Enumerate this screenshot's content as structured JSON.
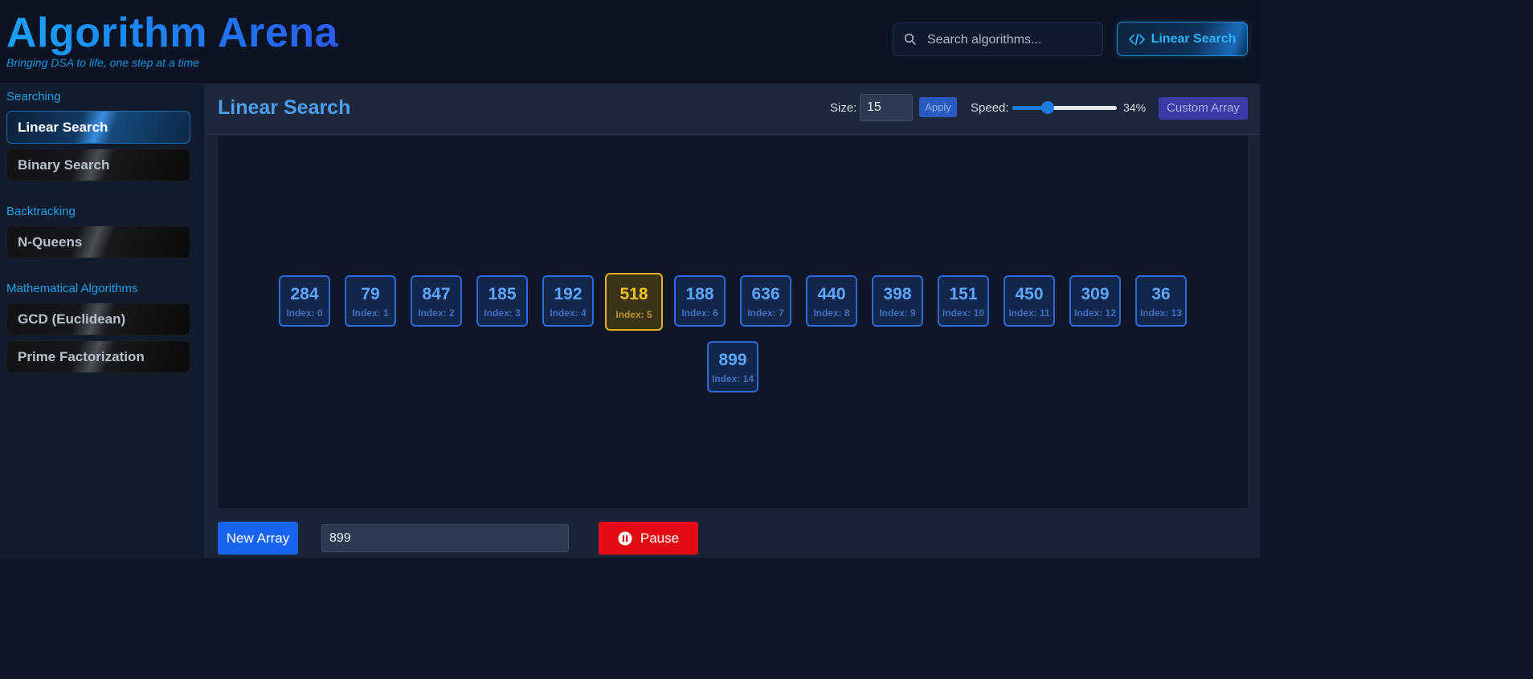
{
  "header": {
    "title": "Algorithm Arena",
    "tagline": "Bringing DSA to life, one step at a time",
    "search_placeholder": "Search algorithms...",
    "current_algorithm": "Linear Search"
  },
  "sidebar": {
    "groups": [
      {
        "title": "Searching",
        "items": [
          {
            "label": "Linear Search",
            "active": true
          },
          {
            "label": "Binary Search"
          }
        ]
      },
      {
        "title": "Backtracking",
        "items": [
          {
            "label": "N-Queens"
          }
        ]
      },
      {
        "title": "Mathematical Algorithms",
        "items": [
          {
            "label": "GCD (Euclidean)"
          },
          {
            "label": "Prime Factorization"
          }
        ]
      }
    ]
  },
  "main": {
    "title": "Linear Search",
    "size_label": "Size:",
    "size_value": "15",
    "apply_label": "Apply",
    "speed_label": "Speed:",
    "speed_percent": 34,
    "speed_text": "34%",
    "custom_array_label": "Custom Array",
    "array": [
      {
        "value": "284",
        "index": "Index: 0"
      },
      {
        "value": "79",
        "index": "Index: 1"
      },
      {
        "value": "847",
        "index": "Index: 2"
      },
      {
        "value": "185",
        "index": "Index: 3"
      },
      {
        "value": "192",
        "index": "Index: 4"
      },
      {
        "value": "518",
        "index": "Index: 5",
        "current": true
      },
      {
        "value": "188",
        "index": "Index: 6"
      },
      {
        "value": "636",
        "index": "Index: 7"
      },
      {
        "value": "440",
        "index": "Index: 8"
      },
      {
        "value": "398",
        "index": "Index: 9"
      },
      {
        "value": "151",
        "index": "Index: 10"
      },
      {
        "value": "450",
        "index": "Index: 11"
      },
      {
        "value": "309",
        "index": "Index: 12"
      },
      {
        "value": "36",
        "index": "Index: 13"
      },
      {
        "value": "899",
        "index": "Index: 14"
      }
    ],
    "new_array_label": "New Array",
    "target_value": "899",
    "pause_label": "Pause"
  },
  "colors": {
    "accent": "#1e93e0",
    "current_highlight": "#e2b320",
    "pause": "#e40b14",
    "primary_button": "#1663f0"
  }
}
